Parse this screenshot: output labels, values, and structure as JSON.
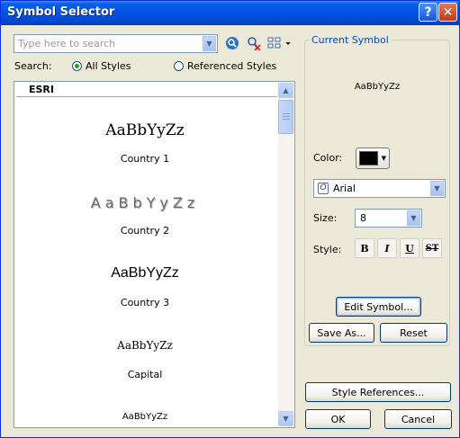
{
  "window": {
    "title": "Symbol Selector",
    "help_label": "?",
    "close_label": "✕"
  },
  "search": {
    "placeholder": "Type here to search",
    "label": "Search:",
    "options": [
      {
        "label": "All Styles",
        "selected": true
      },
      {
        "label": "Referenced Styles",
        "selected": false
      }
    ],
    "icons": [
      "search-icon",
      "clear-search-icon",
      "view-options-icon"
    ]
  },
  "symbol_list": {
    "group": "ESRI",
    "items": [
      {
        "preview": "AaBbYyZz",
        "name": "Country 1"
      },
      {
        "preview": "AaBbYyZz",
        "name": "Country 2"
      },
      {
        "preview": "AaBbYyZz",
        "name": "Country 3"
      },
      {
        "preview": "AaBbYyZz",
        "name": "Capital"
      },
      {
        "preview": "AaBbYyZz",
        "name": ""
      }
    ]
  },
  "current_symbol": {
    "title": "Current Symbol",
    "preview": "AaBbYyZz",
    "color_label": "Color:",
    "color_value": "#000000",
    "font": "Arial",
    "size_label": "Size:",
    "size": "8",
    "style_label": "Style:",
    "style_buttons": [
      "B",
      "I",
      "U",
      "ST"
    ],
    "edit_button": "Edit Symbol...",
    "save_as_button": "Save As...",
    "reset_button": "Reset"
  },
  "footer": {
    "style_references_button": "Style References...",
    "ok_button": "OK",
    "cancel_button": "Cancel"
  }
}
